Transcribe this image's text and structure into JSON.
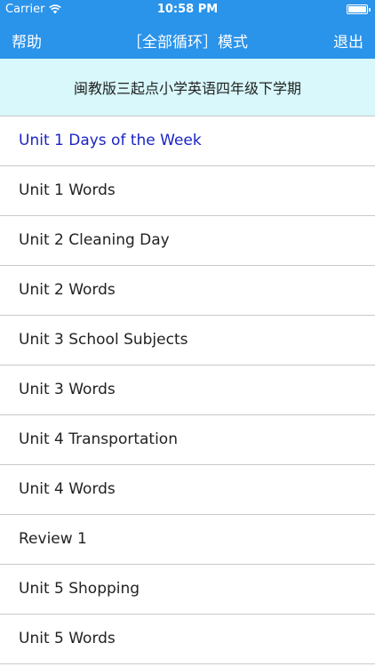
{
  "status_bar": {
    "carrier": "Carrier",
    "time": "10:58 PM"
  },
  "nav": {
    "left_label": "帮助",
    "title": "［全部循环］模式",
    "right_label": "退出"
  },
  "subtitle": "闽教版三起点小学英语四年级下学期",
  "list_items": [
    "Unit 1 Days of the Week",
    "Unit 1 Words",
    "Unit 2 Cleaning Day",
    "Unit 2 Words",
    "Unit 3 School Subjects",
    "Unit 3 Words",
    "Unit 4 Transportation",
    "Unit 4 Words",
    "Review 1",
    "Unit 5 Shopping",
    "Unit 5 Words"
  ],
  "colors": {
    "header": "#2a93ea",
    "subtitle_background": "#d8f8fb",
    "selected_text": "#1c24c4"
  }
}
